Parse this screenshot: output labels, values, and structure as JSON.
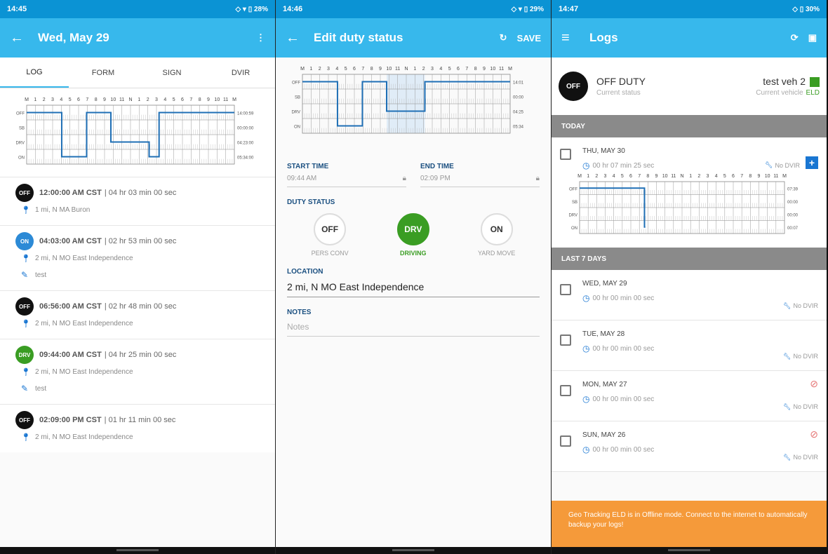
{
  "screen1": {
    "status": {
      "time": "14:45",
      "right": "◇ ▾ ▯ 28%"
    },
    "appbar": {
      "title": "Wed, May 29"
    },
    "tabs": [
      "LOG",
      "FORM",
      "SIGN",
      "DVIR"
    ],
    "chart": {
      "hours": [
        "M",
        "1",
        "2",
        "3",
        "4",
        "5",
        "6",
        "7",
        "8",
        "9",
        "10",
        "11",
        "N",
        "1",
        "2",
        "3",
        "4",
        "5",
        "6",
        "7",
        "8",
        "9",
        "10",
        "11",
        "M"
      ],
      "rows": [
        "OFF",
        "SB",
        "DRV",
        "ON"
      ],
      "totals": [
        "14:00:59",
        "00:00:00",
        "04:23:00",
        "05:34:00"
      ]
    },
    "entries": [
      {
        "badge": "OFF",
        "time": "12:00:00 AM CST",
        "duration": "| 04 hr 03 min 00 sec",
        "location": "1 mi, N MA Buron",
        "note": ""
      },
      {
        "badge": "ON",
        "time": "04:03:00 AM CST",
        "duration": "| 02 hr 53 min 00 sec",
        "location": "2 mi, N MO East Independence",
        "note": "test"
      },
      {
        "badge": "OFF",
        "time": "06:56:00 AM CST",
        "duration": "| 02 hr 48 min 00 sec",
        "location": "2 mi, N MO East Independence",
        "note": ""
      },
      {
        "badge": "DRV",
        "time": "09:44:00 AM CST",
        "duration": "| 04 hr 25 min 00 sec",
        "location": "2 mi, N MO East Independence",
        "note": "test"
      },
      {
        "badge": "OFF",
        "time": "02:09:00 PM CST",
        "duration": "| 01 hr 11 min 00 sec",
        "location": "2 mi, N MO East Independence",
        "note": ""
      }
    ]
  },
  "screen2": {
    "status": {
      "time": "14:46",
      "right": "◇ ▾ ▯ 29%"
    },
    "appbar": {
      "title": "Edit duty status",
      "save": "SAVE"
    },
    "chart": {
      "hours": [
        "M",
        "1",
        "2",
        "3",
        "4",
        "5",
        "6",
        "7",
        "8",
        "9",
        "10",
        "11",
        "N",
        "1",
        "2",
        "3",
        "4",
        "5",
        "6",
        "7",
        "8",
        "9",
        "10",
        "11",
        "M"
      ],
      "rows": [
        "OFF",
        "SB",
        "DRV",
        "ON"
      ],
      "totals": [
        "14:01",
        "00:00",
        "04:25",
        "05:34"
      ]
    },
    "start_label": "START TIME",
    "start_value": "09:44 AM",
    "end_label": "END TIME",
    "end_value": "02:09 PM",
    "duty_label": "DUTY STATUS",
    "options": [
      {
        "code": "OFF",
        "label": "PERS CONV",
        "selected": false
      },
      {
        "code": "DRV",
        "label": "DRIVING",
        "selected": true
      },
      {
        "code": "ON",
        "label": "YARD MOVE",
        "selected": false
      }
    ],
    "location_label": "LOCATION",
    "location_value": "2 mi, N MO East Independence",
    "notes_label": "NOTES",
    "notes_placeholder": "Notes"
  },
  "screen3": {
    "status": {
      "time": "14:47",
      "right": "◇ ▯ 30%"
    },
    "appbar": {
      "title": "Logs"
    },
    "current": {
      "badge": "OFF",
      "status": "OFF DUTY",
      "status_label": "Current status",
      "vehicle": "test veh 2",
      "vehicle_label": "Current vehicle",
      "eld": "ELD"
    },
    "today_label": "TODAY",
    "today": {
      "date": "THU, MAY 30",
      "time": "00 hr 07 min 25 sec",
      "dvir": "No DVIR"
    },
    "chart": {
      "hours": [
        "M",
        "1",
        "2",
        "3",
        "4",
        "5",
        "6",
        "7",
        "8",
        "9",
        "10",
        "11",
        "N",
        "1",
        "2",
        "3",
        "4",
        "5",
        "6",
        "7",
        "8",
        "9",
        "10",
        "11",
        "M"
      ],
      "rows": [
        "OFF",
        "SB",
        "DRV",
        "ON"
      ],
      "totals": [
        "07:39",
        "00:00",
        "00:00",
        "00:07"
      ]
    },
    "last7_label": "LAST 7 DAYS",
    "days": [
      {
        "date": "WED, MAY 29",
        "time": "00 hr 00 min 00 sec",
        "dvir": "No DVIR",
        "warn": false
      },
      {
        "date": "TUE, MAY 28",
        "time": "00 hr 00 min 00 sec",
        "dvir": "No DVIR",
        "warn": false
      },
      {
        "date": "MON, MAY 27",
        "time": "00 hr 00 min 00 sec",
        "dvir": "No DVIR",
        "warn": true
      },
      {
        "date": "SUN, MAY 26",
        "time": "00 hr 00 min 00 sec",
        "dvir": "No DVIR",
        "warn": true
      }
    ],
    "banner": "Geo Tracking ELD is in Offline mode. Connect to the internet to automatically backup your logs!"
  },
  "colors": {
    "appbar": "#37b8ec",
    "statusbar": "#0b93d4",
    "driving": "#3a9d23",
    "on_duty": "#2c8ad6",
    "banner": "#f59a3a"
  }
}
